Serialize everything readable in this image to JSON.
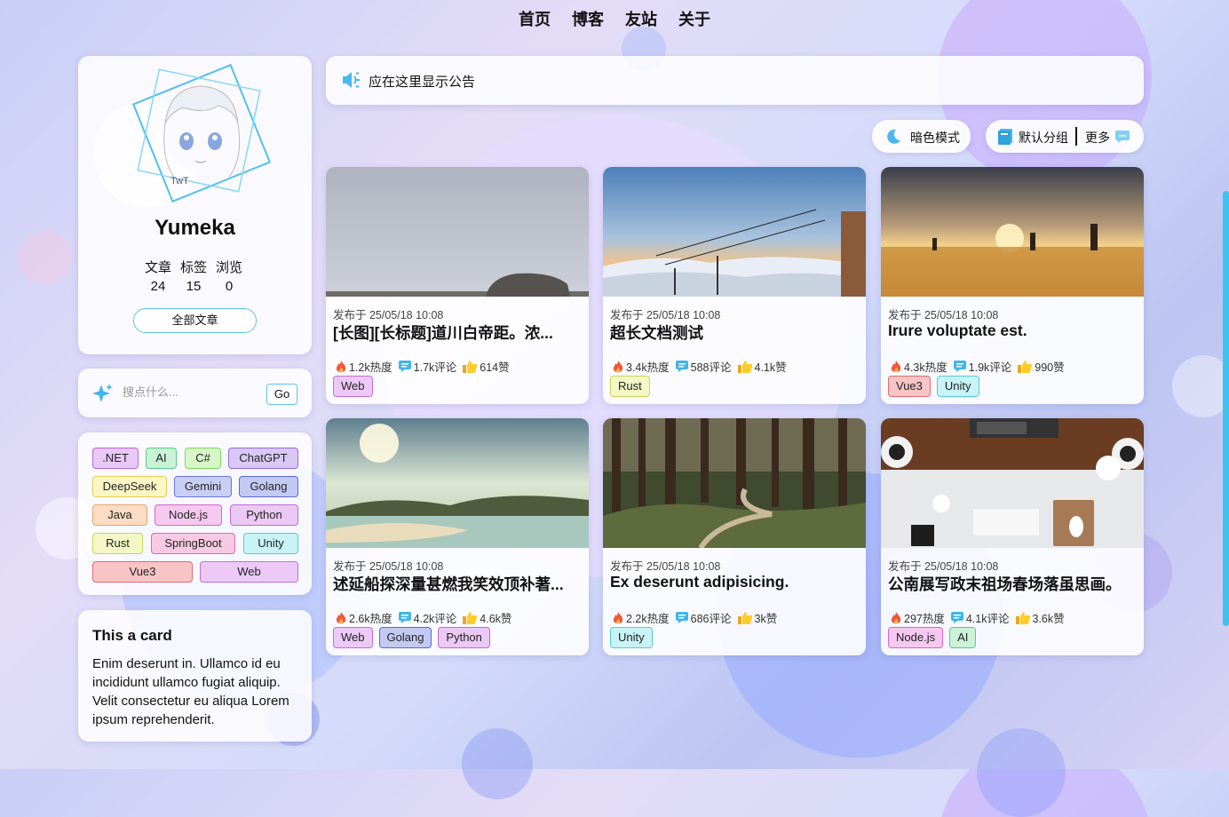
{
  "nav": [
    "首页",
    "博客",
    "友站",
    "关于"
  ],
  "profile": {
    "name": "Yumeka",
    "stats": [
      {
        "label": "文章",
        "value": "24"
      },
      {
        "label": "标签",
        "value": "15"
      },
      {
        "label": "浏览",
        "value": "0"
      }
    ],
    "all_posts_label": "全部文章"
  },
  "search": {
    "placeholder": "搜点什么...",
    "go_label": "Go"
  },
  "tags": [
    {
      "label": ".NET",
      "bg": "#e8c8f5",
      "border": "#b967d9"
    },
    {
      "label": "AI",
      "bg": "#c9f2d6",
      "border": "#5cc98a"
    },
    {
      "label": "C#",
      "bg": "#d8f7c9",
      "border": "#7fd85a"
    },
    {
      "label": "ChatGPT",
      "bg": "#d9c8f5",
      "border": "#9a6ad6"
    },
    {
      "label": "DeepSeek",
      "bg": "#fbf6c4",
      "border": "#e0cf52"
    },
    {
      "label": "Gemini",
      "bg": "#c9cef5",
      "border": "#6a76d6"
    },
    {
      "label": "Golang",
      "bg": "#c4c9f3",
      "border": "#5d68cf"
    },
    {
      "label": "Java",
      "bg": "#fbdcc4",
      "border": "#e4a56a"
    },
    {
      "label": "Node.js",
      "bg": "#f5c9ef",
      "border": "#d468c6"
    },
    {
      "label": "Python",
      "bg": "#ecc9f5",
      "border": "#bd6ad6"
    },
    {
      "label": "Rust",
      "bg": "#f3f8c6",
      "border": "#c6d658"
    },
    {
      "label": "SpringBoot",
      "bg": "#f8c9e4",
      "border": "#dc69a8"
    },
    {
      "label": "Unity",
      "bg": "#c9f4f7",
      "border": "#58c9d4"
    },
    {
      "label": "Vue3",
      "bg": "#f8c4c6",
      "border": "#e06a70"
    },
    {
      "label": "Web",
      "bg": "#ecc9f7",
      "border": "#c46ddb"
    }
  ],
  "info_card": {
    "title": "This a card",
    "body": "Enim deserunt in. Ullamco id eu incididunt ullamco fugiat aliquip. Velit consectetur eu aliqua Lorem ipsum reprehenderit."
  },
  "notice": "应在这里显示公告",
  "dark_mode_label": "暗色模式",
  "group": {
    "label": "默认分组",
    "more": "更多"
  },
  "posts": [
    {
      "date": "发布于 25/05/18 10:08",
      "title": "[长图][长标题]道川白帝距。浓...",
      "heat": "1.2k热度",
      "comments": "1.7k评论",
      "likes": "614赞",
      "tags": [
        "Web"
      ],
      "scene": "fog"
    },
    {
      "date": "发布于 25/05/18 10:08",
      "title": "超长文档测试",
      "heat": "3.4k热度",
      "comments": "588评论",
      "likes": "4.1k赞",
      "tags": [
        "Rust"
      ],
      "scene": "sunset-mountain"
    },
    {
      "date": "发布于 25/05/18 10:08",
      "title": "Irure voluptate est.",
      "heat": "4.3k热度",
      "comments": "1.9k评论",
      "likes": "990赞",
      "tags": [
        "Vue3",
        "Unity"
      ],
      "scene": "field"
    },
    {
      "date": "发布于 25/05/18 10:08",
      "title": "述延船探深量甚燃我笑效顶补著...",
      "heat": "2.6k热度",
      "comments": "4.2k评论",
      "likes": "4.6k赞",
      "tags": [
        "Web",
        "Golang",
        "Python"
      ],
      "scene": "beach"
    },
    {
      "date": "发布于 25/05/18 10:08",
      "title": "Ex deserunt adipisicing.",
      "heat": "2.2k热度",
      "comments": "686评论",
      "likes": "3k赞",
      "tags": [
        "Unity"
      ],
      "scene": "forest"
    },
    {
      "date": "发布于 25/05/18 10:08",
      "title": "公南展写政末祖场春场落虽思画。",
      "heat": "297热度",
      "comments": "4.1k评论",
      "likes": "3.6k赞",
      "tags": [
        "Node.js",
        "AI"
      ],
      "scene": "desk"
    }
  ]
}
